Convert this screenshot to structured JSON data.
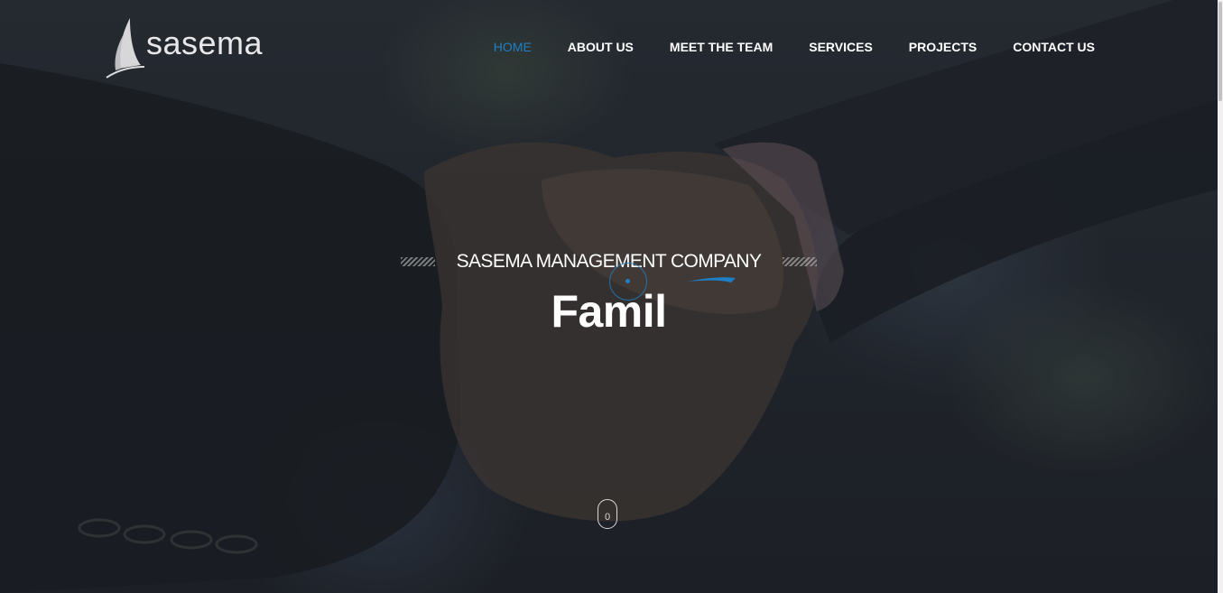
{
  "brand": {
    "name": "sasema"
  },
  "nav": {
    "items": [
      {
        "label": "HOME",
        "active": true
      },
      {
        "label": "ABOUT US",
        "active": false
      },
      {
        "label": "MEET THE TEAM",
        "active": false
      },
      {
        "label": "SERVICES",
        "active": false
      },
      {
        "label": "PROJECTS",
        "active": false
      },
      {
        "label": "CONTACT US",
        "active": false
      }
    ]
  },
  "hero": {
    "tagline": "SASEMA MANAGEMENT COMPANY",
    "headline": "Famil",
    "scroll_indicator": "0"
  },
  "colors": {
    "accent": "#1f7fc4",
    "text": "#ffffff",
    "overlay": "#23272f"
  },
  "icons": {
    "logo": "sail-logo-icon",
    "loader": "spinner-icon",
    "scroll": "mouse-scroll-icon"
  }
}
